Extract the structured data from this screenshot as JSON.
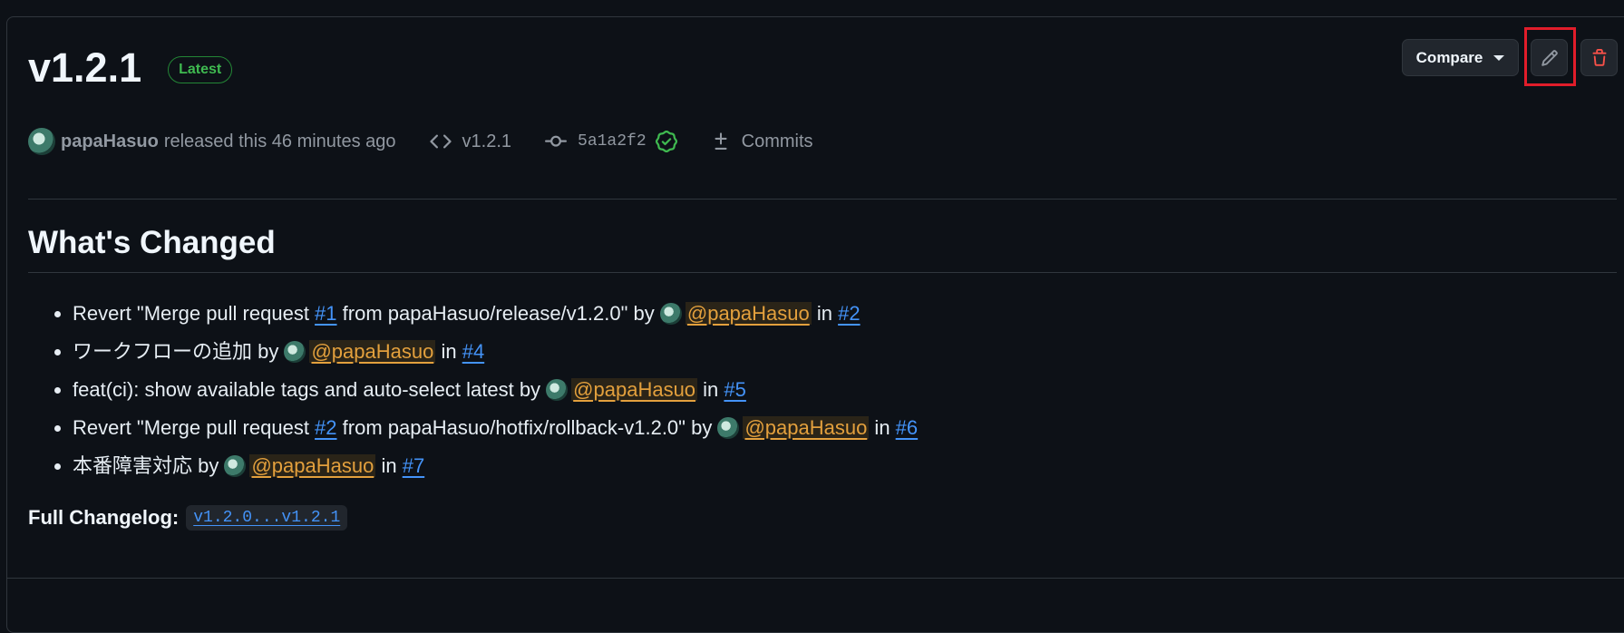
{
  "release": {
    "title": "v1.2.1",
    "badge": "Latest",
    "author": "papaHasuo",
    "released_text": "released this 46 minutes ago",
    "tag": "v1.2.1",
    "commit_sha": "5a1a2f2",
    "commits_label": "Commits"
  },
  "toolbar": {
    "compare_label": "Compare"
  },
  "body": {
    "section_title": "What's Changed",
    "items": [
      {
        "pre": "Revert \"Merge pull request ",
        "pre_link": "#1",
        "mid": " from papaHasuo/release/v1.2.0\" by ",
        "mention": "@papaHasuo",
        "in": " in ",
        "link": "#2"
      },
      {
        "pre": "ワークフローの追加 by ",
        "mention": "@papaHasuo",
        "in": " in ",
        "link": "#4"
      },
      {
        "pre": "feat(ci): show available tags and auto-select latest by ",
        "mention": "@papaHasuo",
        "in": " in ",
        "link": "#5"
      },
      {
        "pre": "Revert \"Merge pull request ",
        "pre_link": "#2",
        "mid": " from papaHasuo/hotfix/rollback-v1.2.0\" by ",
        "mention": "@papaHasuo",
        "in": " in ",
        "link": "#6"
      },
      {
        "pre": "本番障害対応 by ",
        "mention": "@papaHasuo",
        "in": " in ",
        "link": "#7"
      }
    ],
    "changelog_label": "Full Changelog",
    "changelog_colon": ":",
    "changelog_link": "v1.2.0...v1.2.1"
  },
  "icons": {
    "code": "code-icon",
    "commit": "git-commit-icon",
    "verified": "verified-check-icon",
    "diff": "diff-icon",
    "edit": "pencil-icon",
    "delete": "trash-icon"
  },
  "colors": {
    "background": "#0d1117",
    "badge_green": "#3fb950",
    "link_blue": "#4493f8",
    "mention_orange": "#e3a03d",
    "delete_red": "#f85149",
    "highlight_red": "#e11d2a"
  }
}
